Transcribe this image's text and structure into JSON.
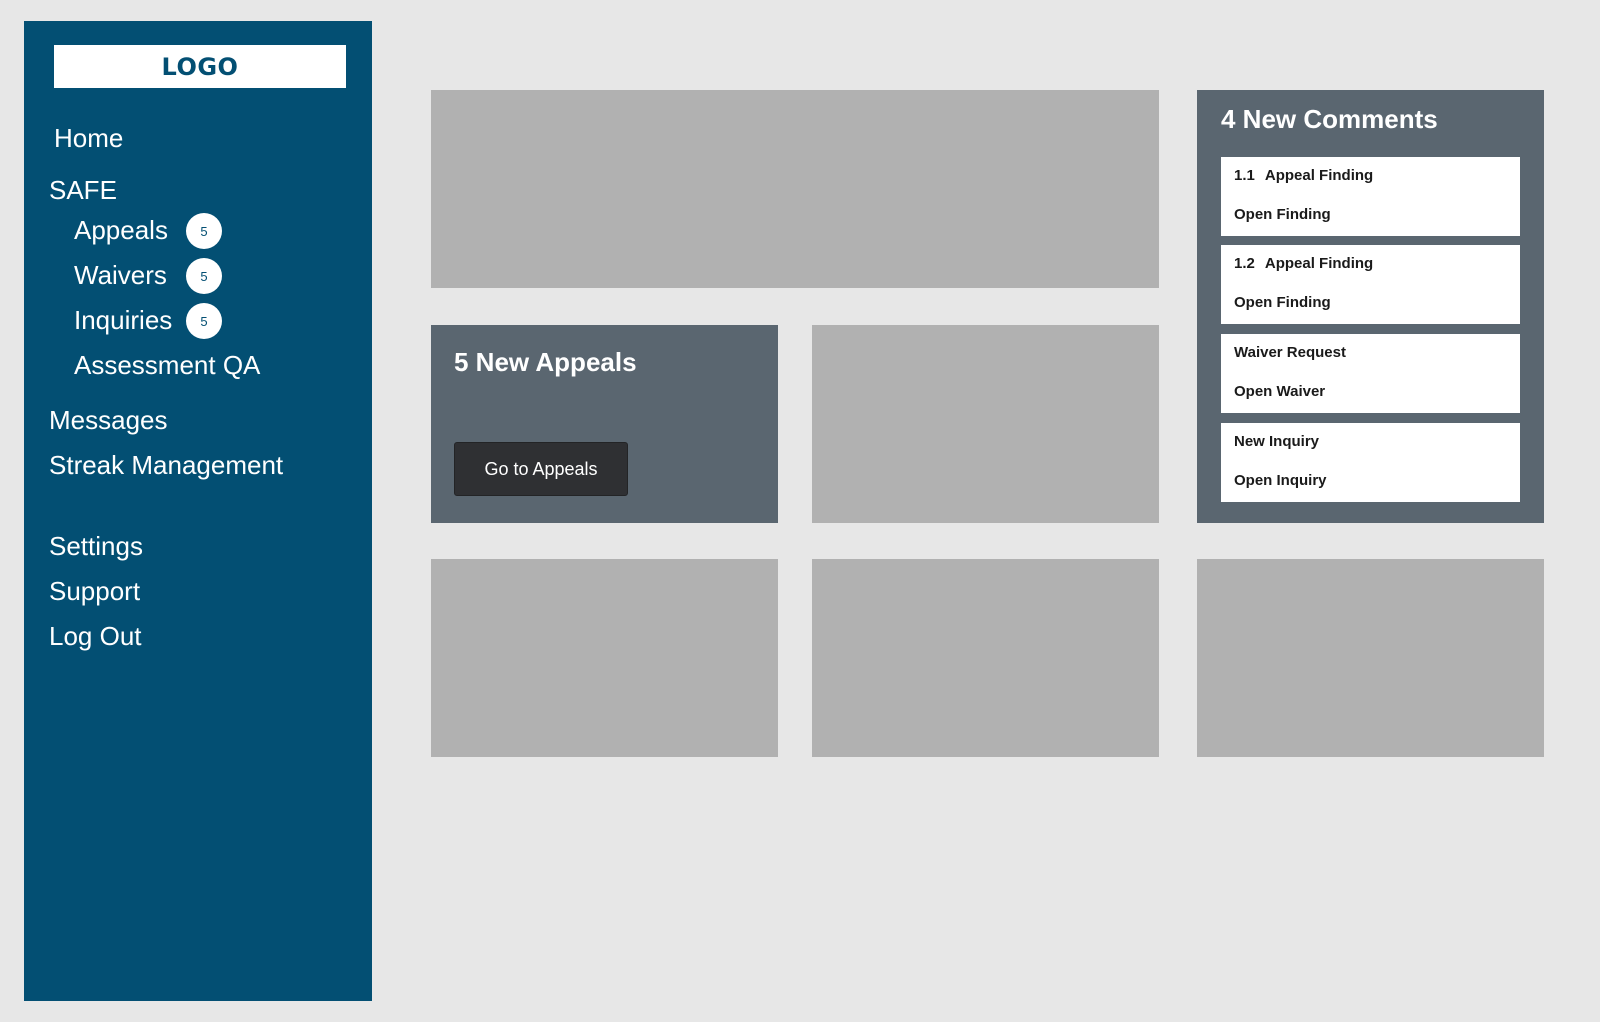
{
  "sidebar": {
    "logo": "LOGO",
    "home": "Home",
    "safe": {
      "label": "SAFE",
      "items": [
        {
          "label": "Appeals",
          "badge": "5"
        },
        {
          "label": "Waivers",
          "badge": "5"
        },
        {
          "label": "Inquiries",
          "badge": "5"
        },
        {
          "label": "Assessment QA"
        }
      ]
    },
    "messages": "Messages",
    "streak": "Streak Management",
    "settings": "Settings",
    "support": "Support",
    "logout": "Log Out"
  },
  "appeals_card": {
    "title": "5 New Appeals",
    "button_label": "Go to Appeals"
  },
  "comments_card": {
    "title": "4 New Comments",
    "items": [
      {
        "number": "1.1",
        "title": "Appeal Finding",
        "action": "Open Finding"
      },
      {
        "number": "1.2",
        "title": "Appeal Finding",
        "action": "Open Finding"
      },
      {
        "number": "",
        "title": "Waiver Request",
        "action": "Open Waiver"
      },
      {
        "number": "",
        "title": "New Inquiry",
        "action": "Open Inquiry"
      }
    ]
  },
  "colors": {
    "sidebar": "#034f73",
    "card": "#5a6670",
    "placeholder": "#b1b1b1",
    "background": "#e7e7e7",
    "button": "#2f3033"
  }
}
